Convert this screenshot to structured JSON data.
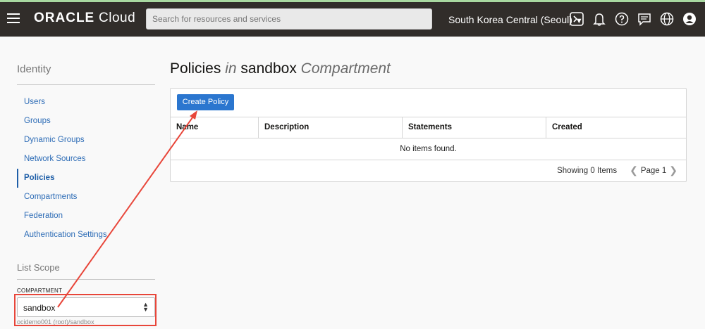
{
  "topbar": {
    "brand_bold": "ORACLE",
    "brand_light": "Cloud",
    "search_placeholder": "Search for resources and services",
    "region": "South Korea Central (Seoul)",
    "colors": {
      "bar": "#312d2a",
      "accent_top": "#a8d8a0"
    },
    "icons": [
      "hamburger-icon",
      "chevron-down-icon",
      "cloud-shell-icon",
      "bell-icon",
      "help-icon",
      "chat-icon",
      "globe-icon",
      "user-icon"
    ]
  },
  "sidebar": {
    "heading": "Identity",
    "items": [
      {
        "label": "Users"
      },
      {
        "label": "Groups"
      },
      {
        "label": "Dynamic Groups"
      },
      {
        "label": "Network Sources"
      },
      {
        "label": "Policies"
      },
      {
        "label": "Compartments"
      },
      {
        "label": "Federation"
      },
      {
        "label": "Authentication Settings"
      }
    ],
    "active_label": "Policies",
    "scope_heading": "List Scope",
    "compartment_label": "COMPARTMENT",
    "compartment_value": "sandbox",
    "compartment_path": "ocidemo001 (root)/sandbox"
  },
  "main": {
    "title_prefix": "Policies",
    "title_in": "in",
    "title_name": "sandbox",
    "title_suffix": "Compartment",
    "create_button": "Create Policy",
    "columns": [
      "Name",
      "Description",
      "Statements",
      "Created"
    ],
    "empty_text": "No items found.",
    "showing": "Showing 0 Items",
    "page": "Page 1"
  },
  "annotation": {
    "color": "#e8463a"
  }
}
